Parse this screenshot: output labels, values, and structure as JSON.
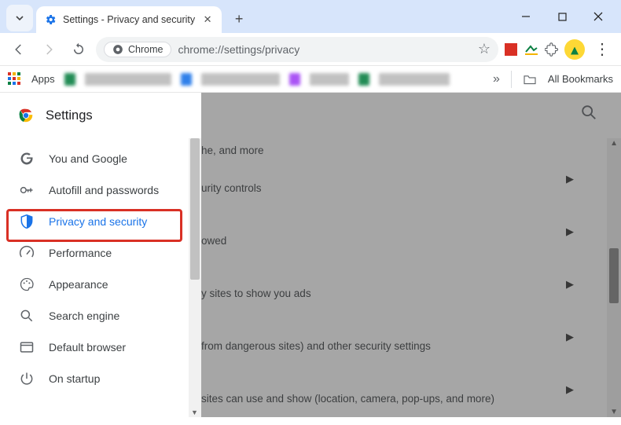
{
  "window": {
    "tab_title": "Settings - Privacy and security"
  },
  "toolbar": {
    "chip_label": "Chrome",
    "url": "chrome://settings/privacy",
    "apps_label": "Apps",
    "all_bookmarks": "All Bookmarks"
  },
  "sidebar": {
    "title": "Settings",
    "items": [
      {
        "label": "You and Google"
      },
      {
        "label": "Autofill and passwords"
      },
      {
        "label": "Privacy and security"
      },
      {
        "label": "Performance"
      },
      {
        "label": "Appearance"
      },
      {
        "label": "Search engine"
      },
      {
        "label": "Default browser"
      },
      {
        "label": "On startup"
      }
    ]
  },
  "main": {
    "rows": [
      "he, and more",
      "urity controls",
      "owed",
      "y sites to show you ads",
      "from dangerous sites) and other security settings",
      "sites can use and show (location, camera, pop-ups, and more)"
    ]
  },
  "status": "chrome://settings/privacy"
}
